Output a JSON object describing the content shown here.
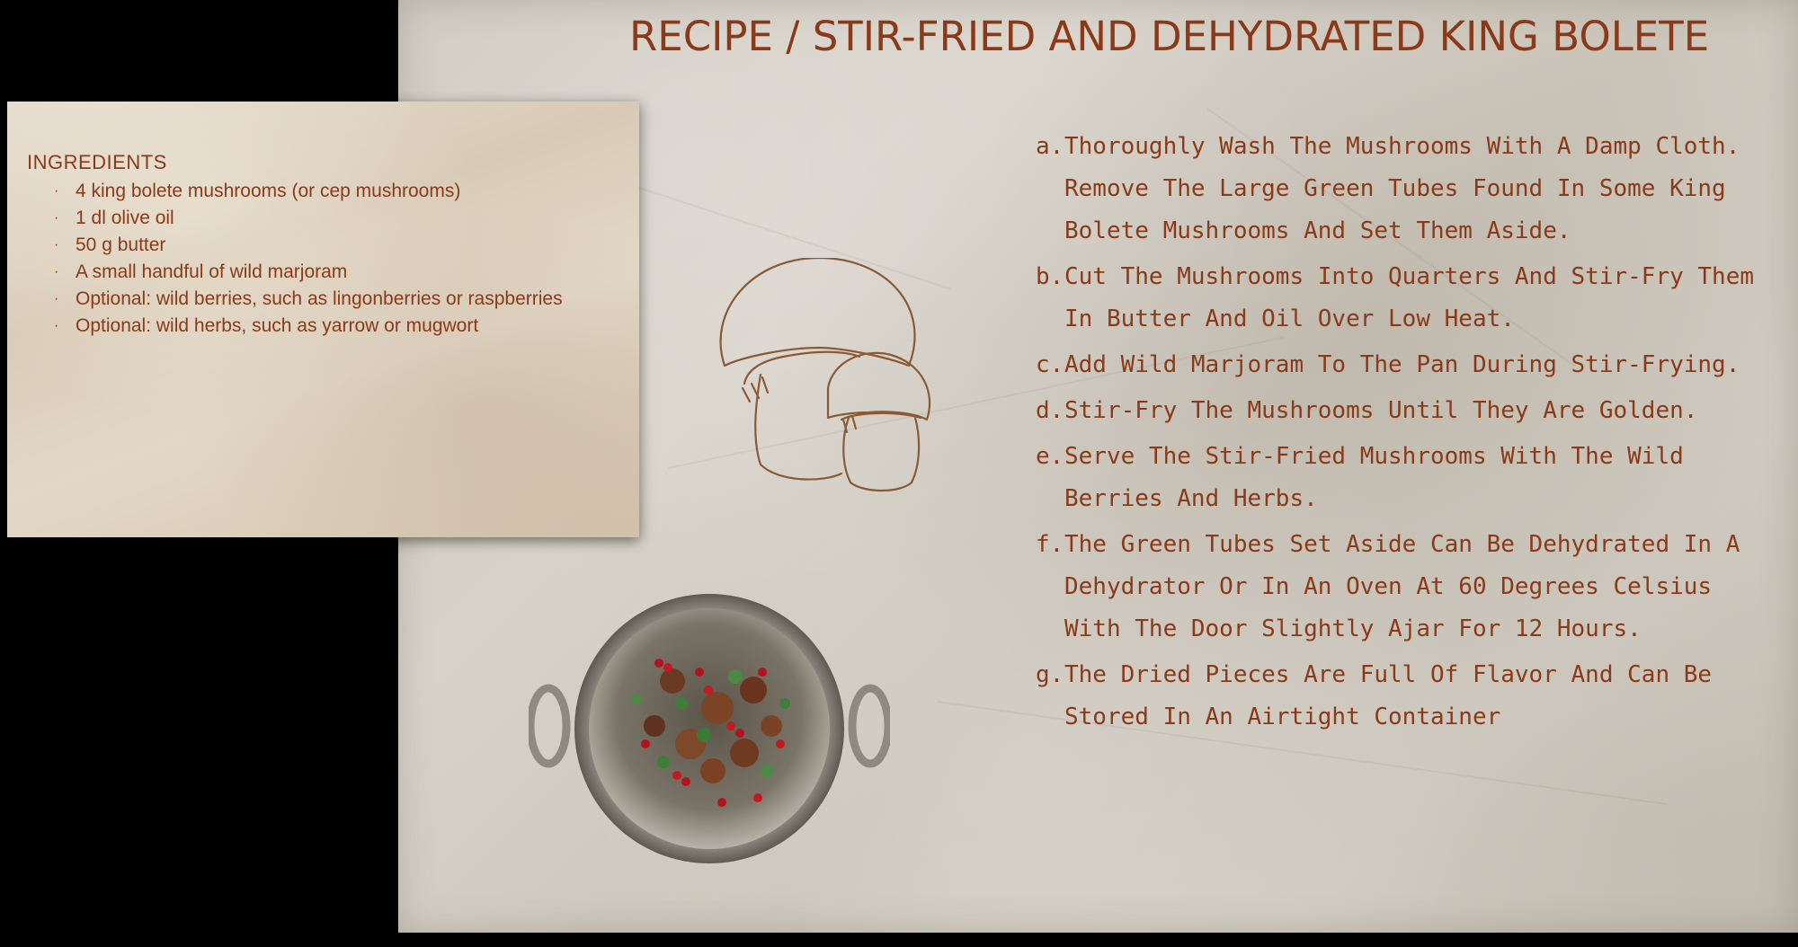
{
  "title": "RECIPE / STIR-FRIED AND DEHYDRATED KING BOLETE",
  "ingredients": {
    "heading": "INGREDIENTS",
    "items": [
      "4 king bolete mushrooms (or cep mushrooms)",
      "1 dl olive oil",
      "50 g butter",
      "A small handful of wild marjoram",
      "Optional: wild berries, such as lingonberries or raspberries",
      "Optional: wild herbs, such as yarrow or mugwort"
    ],
    "bullet": "·"
  },
  "steps": [
    {
      "marker": "a.",
      "text": "Thoroughly Wash The Mushrooms With A Damp Cloth. Remove The Large Green Tubes Found In Some King Bolete Mushrooms And Set Them Aside."
    },
    {
      "marker": "b.",
      "text": "Cut The Mushrooms Into Quarters And Stir-Fry Them In Butter And Oil Over Low Heat."
    },
    {
      "marker": "c.",
      "text": "Add Wild Marjoram To The Pan During Stir-Frying."
    },
    {
      "marker": "d.",
      "text": "Stir-Fry The Mushrooms Until They Are Golden."
    },
    {
      "marker": "e.",
      "text": "Serve The Stir-Fried Mushrooms With The Wild Berries And Herbs."
    },
    {
      "marker": "f.",
      "text": "The Green Tubes Set Aside Can Be Dehydrated In A Dehydrator Or In An Oven At 60 Degrees Celsius With The Door Slightly Ajar For 12 Hours."
    },
    {
      "marker": "g.",
      "text": "The Dried Pieces Are Full Of Flavor And Can Be Stored In An Airtight Container"
    }
  ],
  "illustration": {
    "icon": "mushroom-outline-icon"
  },
  "photo": {
    "icon": "pan-with-mushrooms-and-berries"
  },
  "colors": {
    "text_accent": "#8a3a18",
    "paper": "#d3cdc3",
    "card_paper": "#ddd0bd",
    "background": "#000000"
  }
}
